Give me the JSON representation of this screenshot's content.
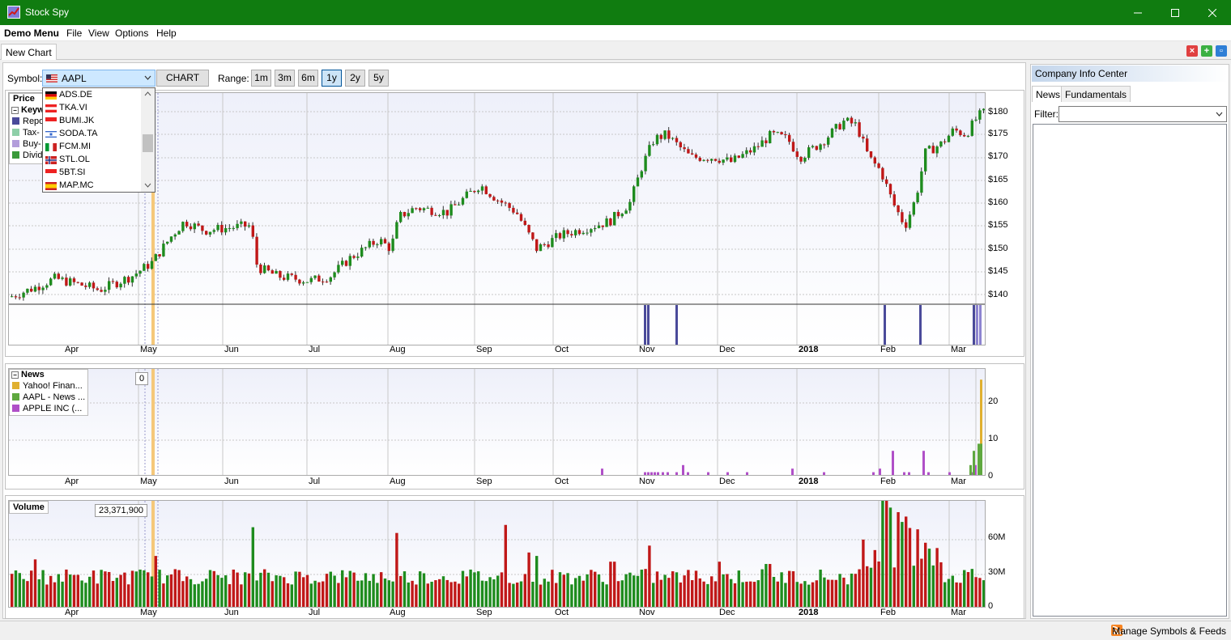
{
  "window": {
    "title": "Stock Spy",
    "app_icon": "stock-spy-chart-icon",
    "controls": [
      "minimize-icon",
      "maximize-icon",
      "close-icon"
    ]
  },
  "menu": [
    {
      "label": "Demo Menu",
      "bold": true
    },
    {
      "label": "File"
    },
    {
      "label": "View"
    },
    {
      "label": "Options"
    },
    {
      "label": "Help"
    }
  ],
  "tabs": {
    "active": "New Chart",
    "controls": [
      "close-tab-icon",
      "add-tab-icon",
      "detach-tab-icon"
    ]
  },
  "toolbar": {
    "symbol_label": "Symbol:",
    "symbol_value": "AAPL",
    "chart_button": "CHART",
    "range_label": "Range:",
    "ranges": [
      "1m",
      "3m",
      "6m",
      "1y",
      "2y",
      "5y"
    ],
    "active_range": "1y"
  },
  "symbol_dropdown": [
    {
      "symbol": "ADS.DE",
      "flag": "de"
    },
    {
      "symbol": "TKA.VI",
      "flag": "at"
    },
    {
      "symbol": "BUMI.JK",
      "flag": "id"
    },
    {
      "symbol": "SODA.TA",
      "flag": "il"
    },
    {
      "symbol": "FCM.MI",
      "flag": "it"
    },
    {
      "symbol": "STL.OL",
      "flag": "no"
    },
    {
      "symbol": "5BT.SI",
      "flag": "sg"
    },
    {
      "symbol": "MAP.MC",
      "flag": "es"
    }
  ],
  "months": [
    "Apr",
    "May",
    "Jun",
    "Jul",
    "Aug",
    "Sep",
    "Oct",
    "Nov",
    "Dec",
    "2018",
    "Feb",
    "Mar"
  ],
  "price_panel": {
    "legend_title": "Price",
    "legend_group": "Keyw",
    "legend_items": [
      {
        "label": "Repo",
        "color": "#4a4a9a"
      },
      {
        "label": "Tax-",
        "color": "#8ecfa8"
      },
      {
        "label": "Buy-",
        "color": "#b39ddb"
      },
      {
        "label": "Divid",
        "color": "#3a9a3a"
      }
    ],
    "y_ticks": [
      "$180",
      "$175",
      "$170",
      "$165",
      "$160",
      "$155",
      "$150",
      "$145",
      "$140"
    ]
  },
  "news_panel": {
    "legend_group": "News",
    "legend_items": [
      {
        "label": "Yahoo! Finan...",
        "color": "#e0b030"
      },
      {
        "label": "AAPL - News ...",
        "color": "#5fa83f"
      },
      {
        "label": "APPLE INC  (...",
        "color": "#b050c8"
      }
    ],
    "tooltip": "0",
    "y_ticks": [
      "20",
      "10",
      "0"
    ]
  },
  "volume_panel": {
    "legend_title": "Volume",
    "tooltip": "23,371,900",
    "y_ticks": [
      "60M",
      "30M",
      "0"
    ]
  },
  "info_center": {
    "title": "Company Info Center",
    "tabs": [
      "News",
      "Fundamentals"
    ],
    "active_tab": "News",
    "filter_label": "Filter:"
  },
  "status": {
    "text": "Manage Symbols & Feeds",
    "icon": "rss-feed-icon"
  },
  "colors": {
    "up": "#1e8c1e",
    "down": "#c01818",
    "titlebar": "#107c10",
    "highlight": "#f5c87a"
  }
}
